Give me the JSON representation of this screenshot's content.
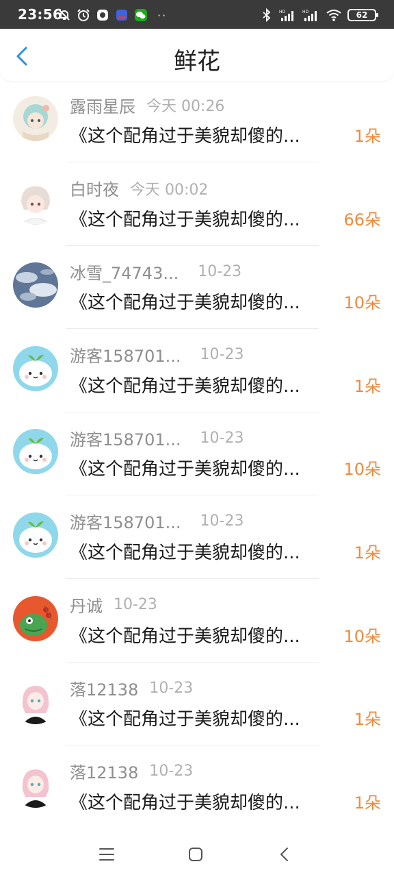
{
  "status_bar": {
    "time": "23:56",
    "battery": "62",
    "icons_left": [
      "mute-bell-icon",
      "alarm-icon",
      "app-icon",
      "baidu-app-icon",
      "wechat-icon"
    ],
    "more": "··",
    "icons_right": [
      "bluetooth-icon",
      "signal-hd-icon",
      "signal-hd-icon",
      "wifi-icon",
      "battery-icon"
    ]
  },
  "header": {
    "title": "鲜花",
    "back_icon": "chevron-left-icon",
    "accent": "#2f8fe0"
  },
  "colors": {
    "count": "#f08a3c",
    "name": "#8e8e8e",
    "time": "#b0b0b0"
  },
  "rows": [
    {
      "name": "露雨星辰",
      "time": "今天 00:26",
      "message": "《这个配角过于美貌却傻的...",
      "count": "1朵",
      "avatar": "anime-girl-avatar"
    },
    {
      "name": "白时夜",
      "time": "今天 00:02",
      "message": "《这个配角过于美貌却傻的...",
      "count": "66朵",
      "avatar": "white-hair-avatar"
    },
    {
      "name": "冰雪_74743...",
      "time": "10-23",
      "message": "《这个配角过于美貌却傻的...",
      "count": "10朵",
      "avatar": "cloud-sky-avatar"
    },
    {
      "name": "游客158701...",
      "time": "10-23",
      "message": "《这个配角过于美貌却傻的...",
      "count": "1朵",
      "avatar": "sprout-mascot-avatar"
    },
    {
      "name": "游客158701...",
      "time": "10-23",
      "message": "《这个配角过于美貌却傻的...",
      "count": "10朵",
      "avatar": "sprout-mascot-avatar"
    },
    {
      "name": "游客158701...",
      "time": "10-23",
      "message": "《这个配角过于美貌却傻的...",
      "count": "1朵",
      "avatar": "sprout-mascot-avatar"
    },
    {
      "name": "丹诚",
      "time": "10-23",
      "message": "《这个配角过于美貌却傻的...",
      "count": "10朵",
      "avatar": "green-dino-avatar"
    },
    {
      "name": "落12138",
      "time": "10-23",
      "message": "《这个配角过于美貌却傻的...",
      "count": "1朵",
      "avatar": "pink-hair-avatar"
    },
    {
      "name": "落12138",
      "time": "10-23",
      "message": "《这个配角过于美貌却傻的...",
      "count": "1朵",
      "avatar": "pink-hair-avatar"
    }
  ],
  "nav_bar": {
    "items": [
      "menu-icon",
      "home-icon",
      "back-icon"
    ]
  }
}
